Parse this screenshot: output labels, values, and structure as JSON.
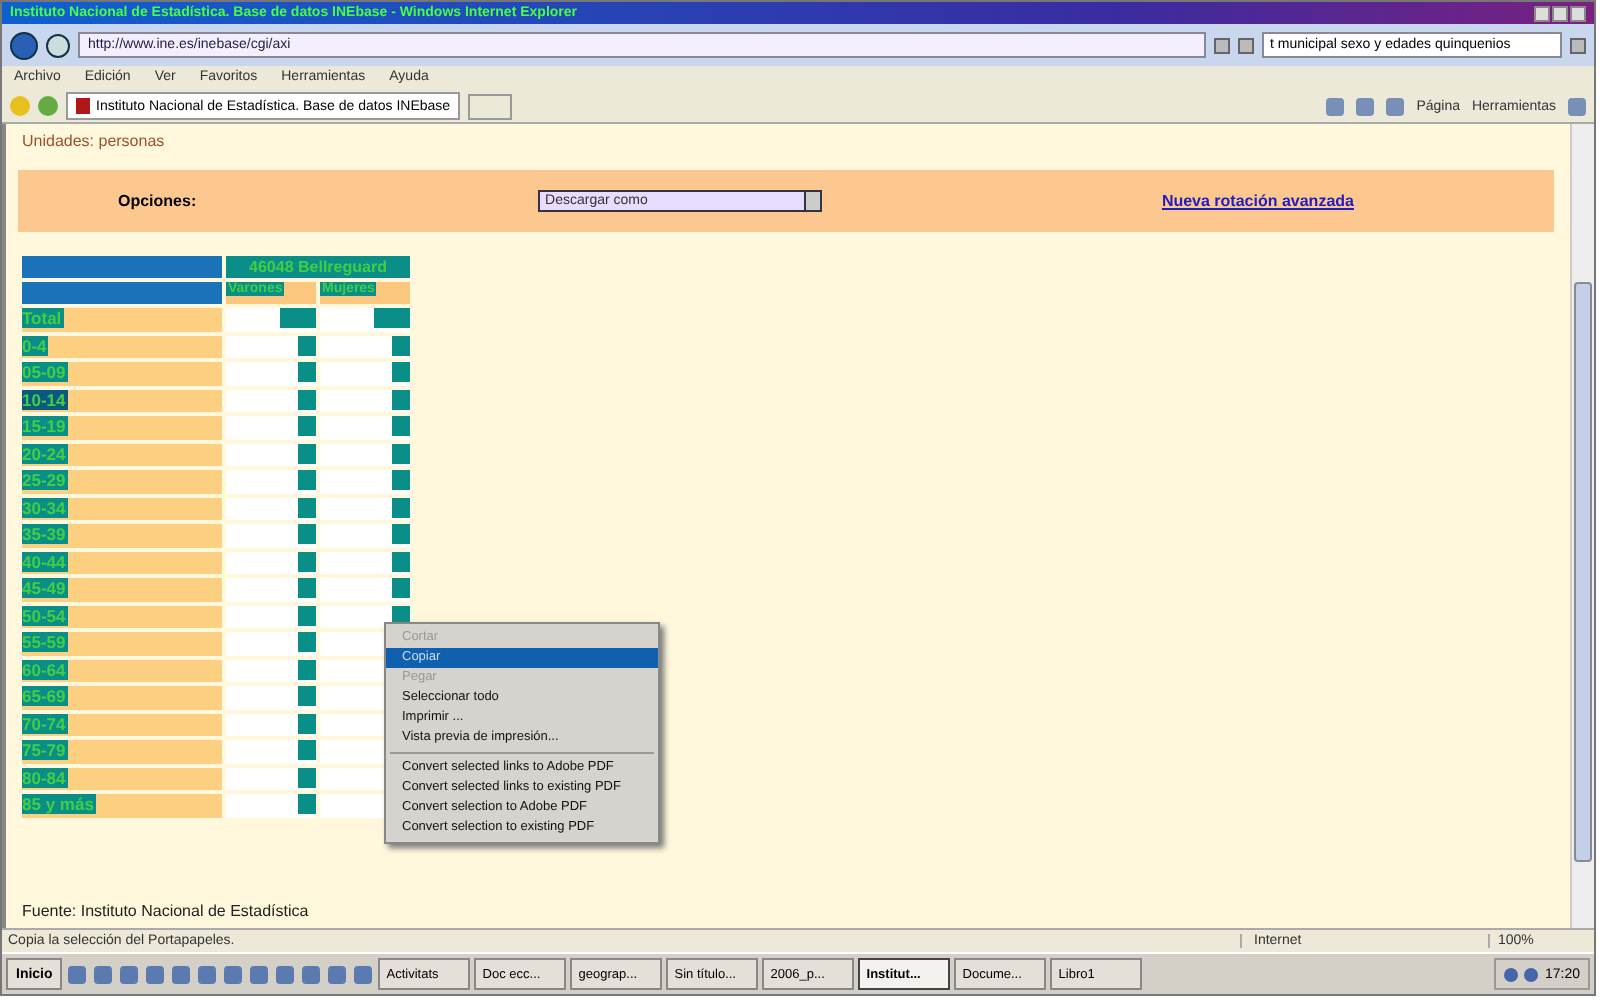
{
  "window": {
    "title": "Instituto Nacional de Estadística. Base de datos INEbase - Windows Internet Explorer"
  },
  "address_bar": {
    "url": "http://www.ine.es/inebase/cgi/axi",
    "search_value": "t municipal sexo y edades quinquenios"
  },
  "menu_bar": [
    "Archivo",
    "Edición",
    "Ver",
    "Favoritos",
    "Herramientas",
    "Ayuda"
  ],
  "tab": {
    "label": "Instituto Nacional de Estadística. Base de datos INEbase"
  },
  "command_bar": [
    "Página",
    "Herramientas"
  ],
  "page": {
    "units": "Unidades: personas",
    "options_label": "Opciones:",
    "download_select": "Descargar como",
    "advanced_link": "Nueva rotación avanzada",
    "table": {
      "place": "46048 Bellreguard",
      "columns": [
        "Varones",
        "Mujeres"
      ],
      "rows": [
        "Total",
        "0-4",
        "05-09",
        "10-14",
        "15-19",
        "20-24",
        "25-29",
        "30-34",
        "35-39",
        "40-44",
        "45-49",
        "50-54",
        "55-59",
        "60-64",
        "65-69",
        "70-74",
        "75-79",
        "80-84",
        "85 y más"
      ]
    },
    "source": "Fuente: Instituto Nacional de Estadística"
  },
  "context_menu": [
    {
      "label": "Cortar",
      "disabled": true,
      "selected": false
    },
    {
      "label": "Copiar",
      "disabled": false,
      "selected": true
    },
    {
      "label": "Pegar",
      "disabled": true,
      "selected": false
    },
    {
      "label": "Seleccionar todo",
      "disabled": false,
      "selected": false
    },
    {
      "label": "Imprimir ...",
      "disabled": false,
      "selected": false
    },
    {
      "label": "Vista previa de impresión...",
      "disabled": false,
      "selected": false,
      "separator_after": true
    },
    {
      "label": "Convert selected links to Adobe PDF",
      "disabled": false,
      "selected": false
    },
    {
      "label": "Convert selected links to existing PDF",
      "disabled": false,
      "selected": false
    },
    {
      "label": "Convert selection to Adobe PDF",
      "disabled": false,
      "selected": false
    },
    {
      "label": "Convert selection to existing PDF",
      "disabled": false,
      "selected": false
    }
  ],
  "status_bar": {
    "message": "Copia la selección del Portapapeles.",
    "zone": "Internet",
    "zoom": "100%"
  },
  "taskbar": {
    "start": "Inicio",
    "tasks": [
      {
        "label": "Activitats",
        "selected": false
      },
      {
        "label": "Doc ecc...",
        "selected": false
      },
      {
        "label": "geograp...",
        "selected": false
      },
      {
        "label": "Sin título...",
        "selected": false
      },
      {
        "label": "2006_p...",
        "selected": false
      },
      {
        "label": "Institut...",
        "selected": true
      },
      {
        "label": "Docume...",
        "selected": false
      },
      {
        "label": "Libro1",
        "selected": false
      }
    ],
    "clock": "17:20"
  }
}
